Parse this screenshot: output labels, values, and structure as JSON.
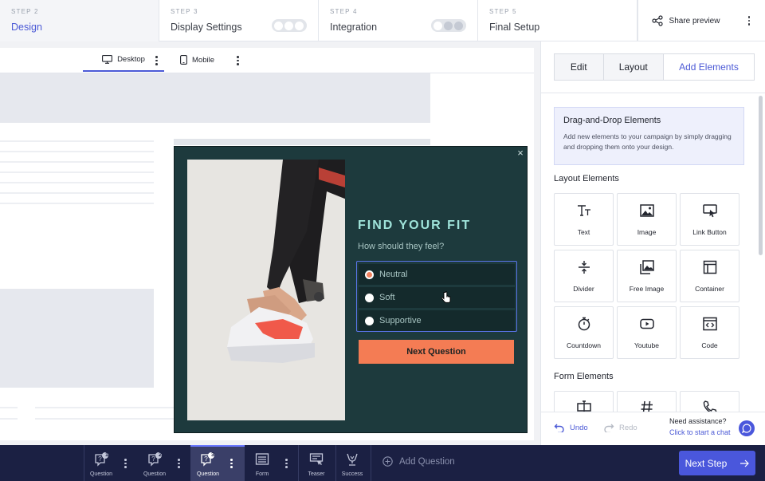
{
  "steps": [
    {
      "label": "STEP 2",
      "title": "Design"
    },
    {
      "label": "STEP 3",
      "title": "Display Settings"
    },
    {
      "label": "STEP 4",
      "title": "Integration"
    },
    {
      "label": "STEP 5",
      "title": "Final Setup"
    }
  ],
  "header": {
    "share_label": "Share preview"
  },
  "device_tabs": {
    "desktop": "Desktop",
    "mobile": "Mobile"
  },
  "popup": {
    "title": "FIND YOUR FIT",
    "subtitle": "How should they feel?",
    "options": [
      "Neutral",
      "Soft",
      "Supportive"
    ],
    "selected_option": "Neutral",
    "button": "Next Question",
    "close": "×"
  },
  "panel": {
    "tabs": [
      "Edit",
      "Layout",
      "Add Elements"
    ],
    "active_tab": "Add Elements",
    "dnd_title": "Drag-and-Drop Elements",
    "dnd_text": "Add new elements to your campaign by simply dragging and dropping them onto your design.",
    "layout_section": "Layout Elements",
    "layout_elements": [
      {
        "label": "Text",
        "icon": "text-icon"
      },
      {
        "label": "Image",
        "icon": "image-icon"
      },
      {
        "label": "Link Button",
        "icon": "link-button-icon"
      },
      {
        "label": "Divider",
        "icon": "divider-icon"
      },
      {
        "label": "Free Image",
        "icon": "free-image-icon"
      },
      {
        "label": "Container",
        "icon": "container-icon"
      },
      {
        "label": "Countdown",
        "icon": "countdown-icon"
      },
      {
        "label": "Youtube",
        "icon": "youtube-icon"
      },
      {
        "label": "Code",
        "icon": "code-icon"
      }
    ],
    "form_section": "Form Elements",
    "undo": "Undo",
    "redo": "Redo",
    "assist_q": "Need assistance?",
    "assist_link": "Click to start a chat"
  },
  "bottom": {
    "items": [
      {
        "label": "Question",
        "badge": "1"
      },
      {
        "label": "Question",
        "badge": "2"
      },
      {
        "label": "Question",
        "badge": "3"
      },
      {
        "label": "Form"
      },
      {
        "label": "Teaser"
      },
      {
        "label": "Success"
      }
    ],
    "add_question": "Add Question",
    "next_step": "Next Step"
  },
  "colors": {
    "accent": "#4c5ad6",
    "popup_bg": "#1d3a3d",
    "popup_title": "#9fe3da",
    "cta": "#f47c54",
    "bottom_bar": "#1b2043"
  }
}
